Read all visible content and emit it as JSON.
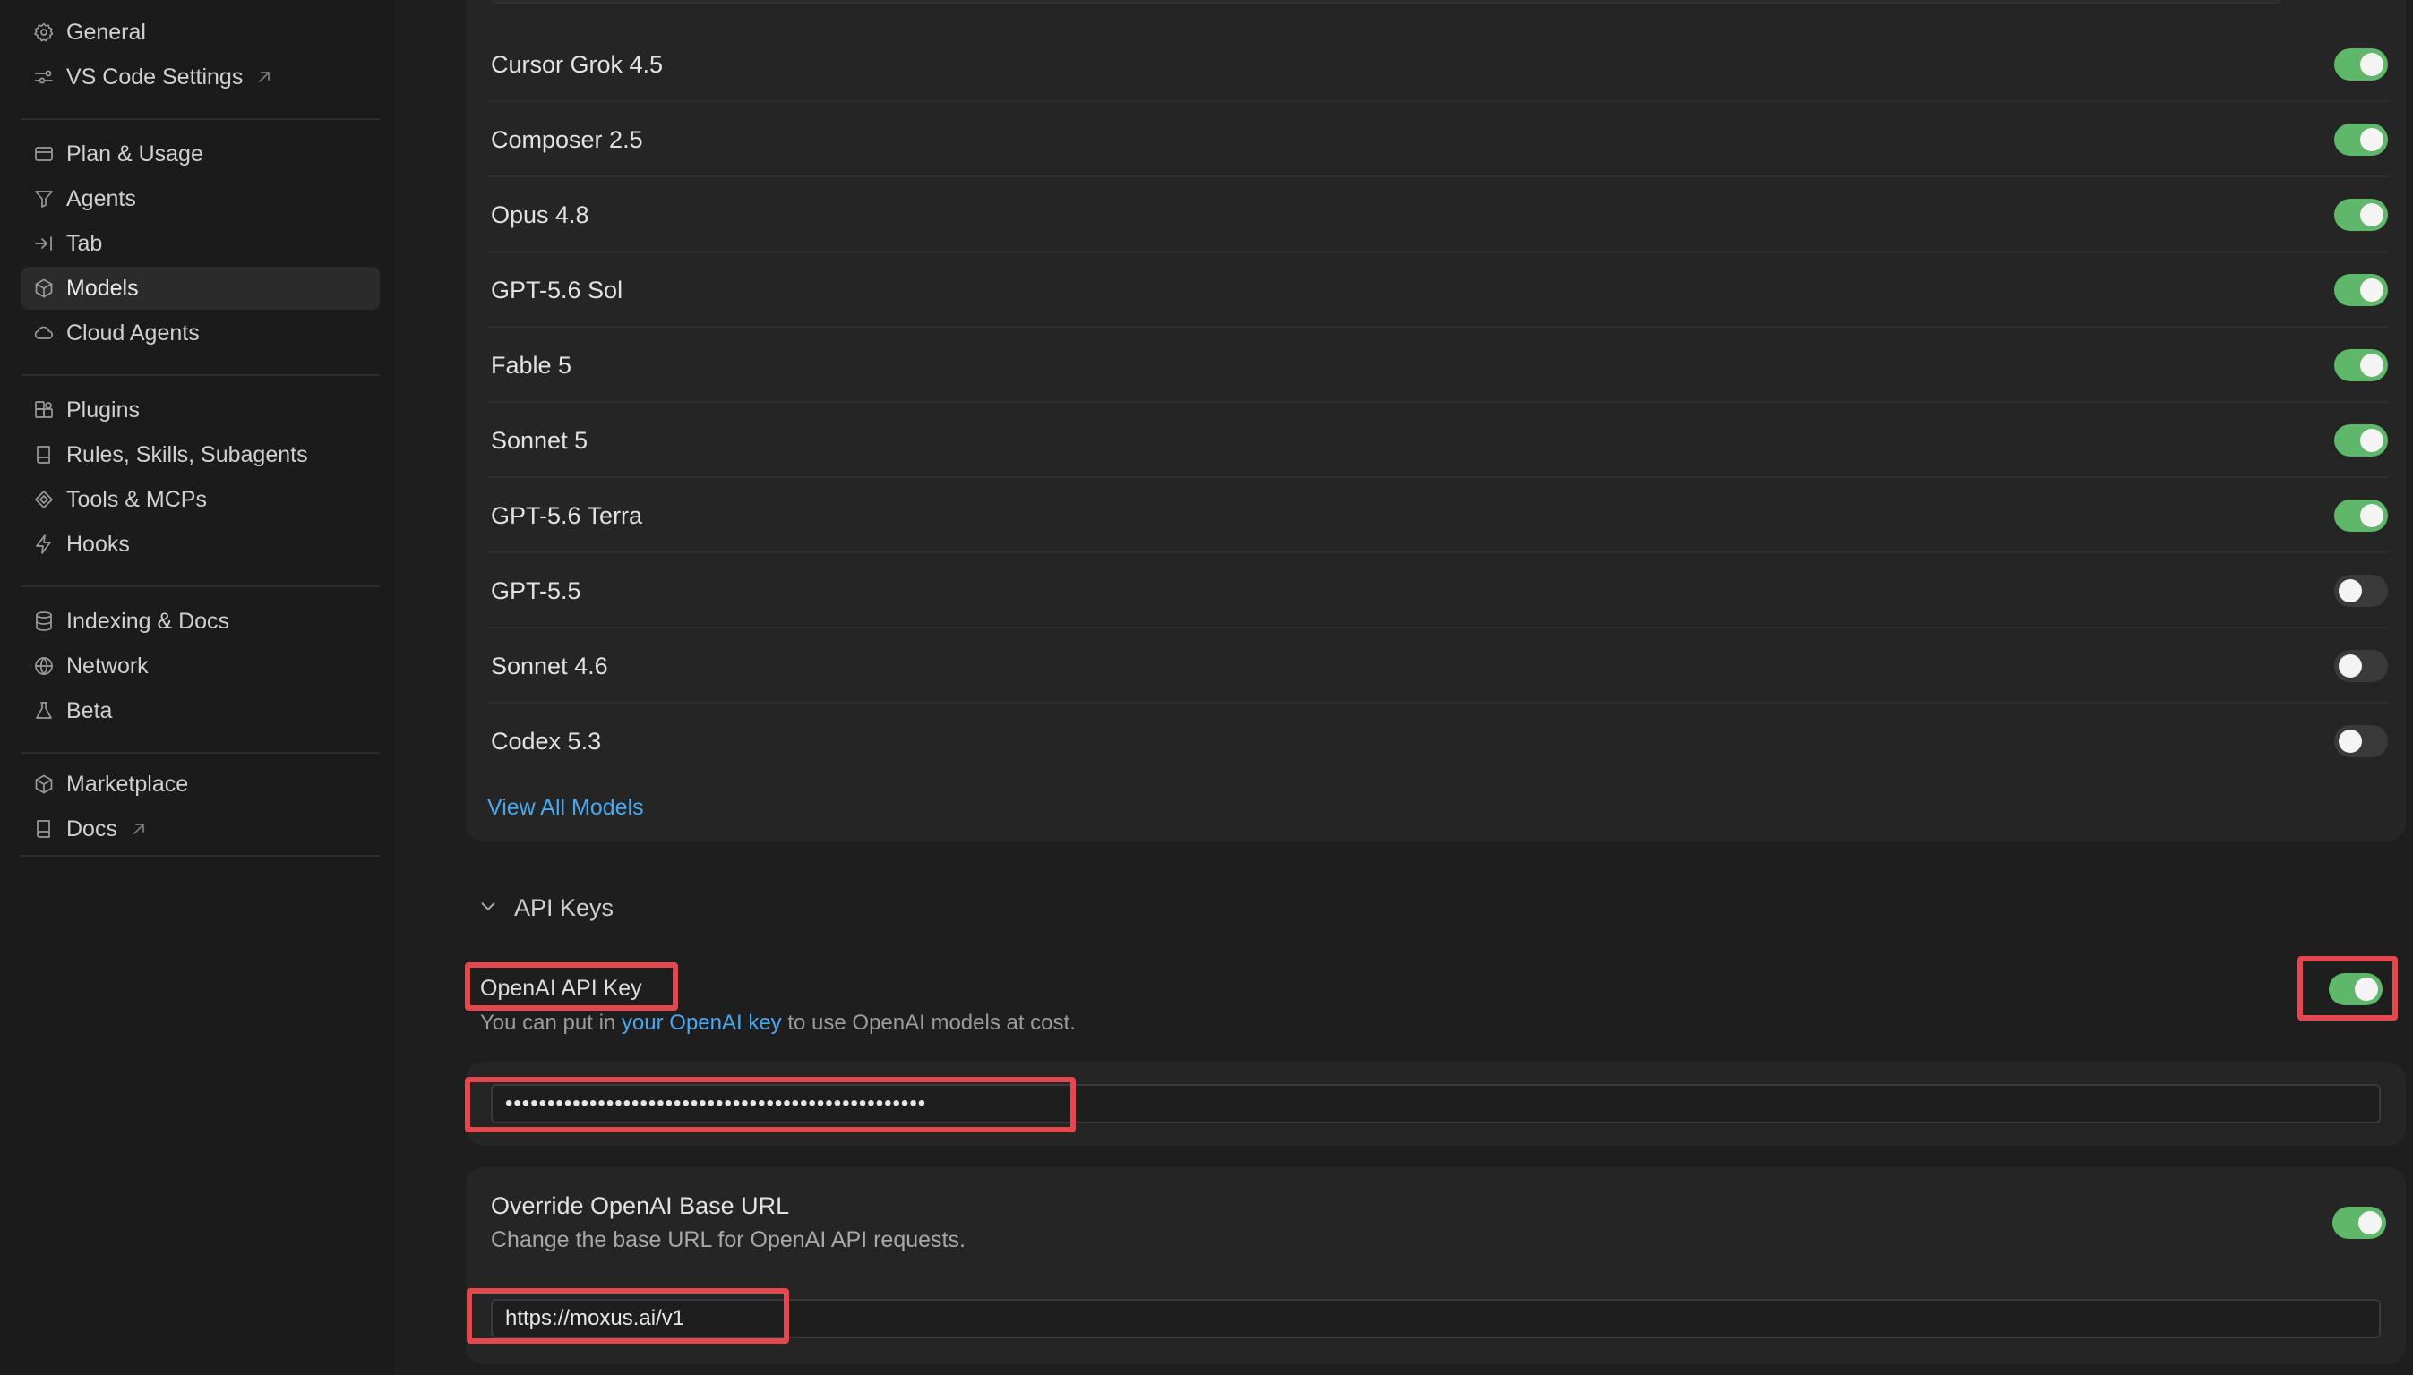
{
  "sidebar": {
    "groups": [
      [
        {
          "label": "General",
          "icon": "gear-icon"
        },
        {
          "label": "VS Code Settings",
          "icon": "settings-sliders-icon",
          "external": true
        }
      ],
      [
        {
          "label": "Plan & Usage",
          "icon": "card-icon"
        },
        {
          "label": "Agents",
          "icon": "funnel-icon"
        },
        {
          "label": "Tab",
          "icon": "tab-arrow-icon"
        },
        {
          "label": "Models",
          "icon": "cube-icon",
          "active": true
        },
        {
          "label": "Cloud Agents",
          "icon": "cloud-icon"
        }
      ],
      [
        {
          "label": "Plugins",
          "icon": "puzzle-icon"
        },
        {
          "label": "Rules, Skills, Subagents",
          "icon": "book-icon"
        },
        {
          "label": "Tools & MCPs",
          "icon": "tools-icon"
        },
        {
          "label": "Hooks",
          "icon": "bolt-icon"
        }
      ],
      [
        {
          "label": "Indexing & Docs",
          "icon": "database-icon"
        },
        {
          "label": "Network",
          "icon": "globe-icon"
        },
        {
          "label": "Beta",
          "icon": "flask-icon"
        }
      ],
      [
        {
          "label": "Marketplace",
          "icon": "cube-icon"
        },
        {
          "label": "Docs",
          "icon": "book-icon",
          "external": true
        }
      ]
    ]
  },
  "models": {
    "items": [
      {
        "name": "Cursor Grok 4.5",
        "enabled": true
      },
      {
        "name": "Composer 2.5",
        "enabled": true
      },
      {
        "name": "Opus 4.8",
        "enabled": true
      },
      {
        "name": "GPT-5.6 Sol",
        "enabled": true
      },
      {
        "name": "Fable 5",
        "enabled": true
      },
      {
        "name": "Sonnet 5",
        "enabled": true
      },
      {
        "name": "GPT-5.6 Terra",
        "enabled": true
      },
      {
        "name": "GPT-5.5",
        "enabled": false
      },
      {
        "name": "Sonnet 4.6",
        "enabled": false
      },
      {
        "name": "Codex 5.3",
        "enabled": false
      }
    ],
    "view_all_label": "View All Models"
  },
  "api_keys": {
    "section_title": "API Keys",
    "openai": {
      "title": "OpenAI API Key",
      "desc_prefix": "You can put in ",
      "desc_link": "your OpenAI key",
      "desc_suffix": " to use OpenAI models at cost.",
      "enabled": true,
      "key_value": "••••••••••••••••••••••••••••••••••••••••••••••••••"
    },
    "override": {
      "title": "Override OpenAI Base URL",
      "desc": "Change the base URL for OpenAI API requests.",
      "enabled": true,
      "url_value": "https://moxus.ai/v1"
    }
  },
  "colors": {
    "toggle_on": "#5fb86a",
    "link": "#4aa8f0",
    "highlight": "#e4484e"
  }
}
